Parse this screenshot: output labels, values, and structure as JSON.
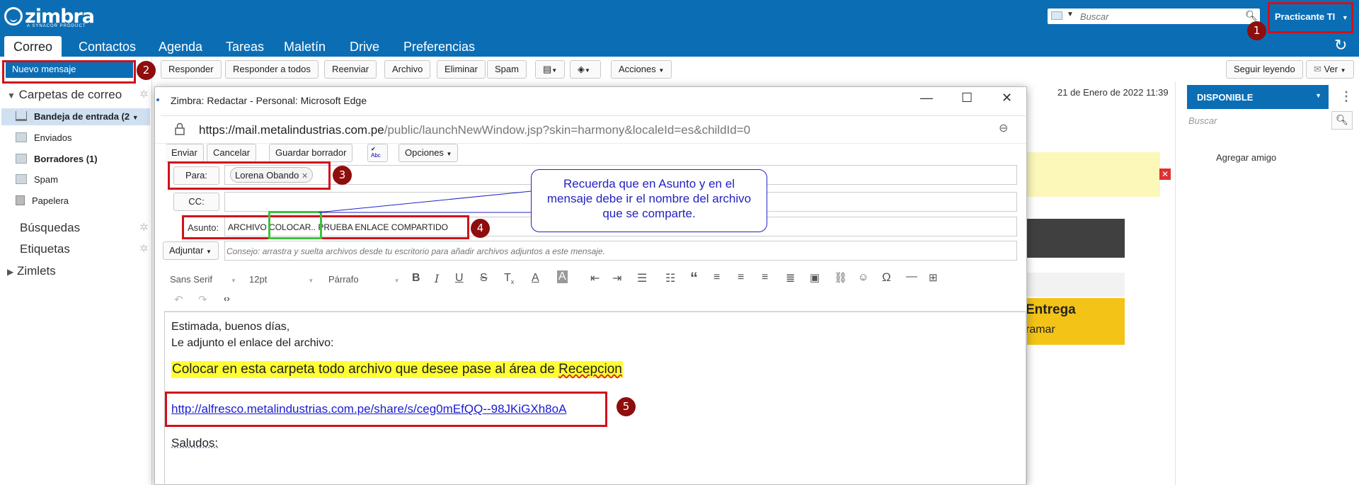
{
  "header": {
    "logo_text": "zimbra",
    "logo_subtext": "A SYNACOR PRODUCT",
    "search_placeholder": "Buscar",
    "user_label": "Practicante TI",
    "tabs": [
      "Correo",
      "Contactos",
      "Agenda",
      "Tareas",
      "Maletín",
      "Drive",
      "Preferencias"
    ],
    "active_tab": "Correo",
    "accent_color": "#0b6eb5"
  },
  "sidebar": {
    "new_message": "Nuevo mensaje",
    "mail_folders_title": "Carpetas de correo",
    "folders": [
      {
        "label": "Bandeja de entrada (2",
        "icon": "inbox-icon",
        "bold": true,
        "selected": true
      },
      {
        "label": "Enviados",
        "icon": "sent-folder-icon",
        "bold": false
      },
      {
        "label": "Borradores (1)",
        "icon": "drafts-folder-icon",
        "bold": true
      },
      {
        "label": "Spam",
        "icon": "spam-folder-icon",
        "bold": false
      },
      {
        "label": "Papelera",
        "icon": "trash-icon",
        "bold": false
      }
    ],
    "searches": "Búsquedas",
    "tags": "Etiquetas",
    "zimlets": "Zimlets"
  },
  "toolbar": {
    "reply": "Responder",
    "reply_all": "Responder a todos",
    "forward": "Reenviar",
    "archive": "Archivo",
    "delete": "Eliminar",
    "spam": "Spam",
    "actions": "Acciones",
    "keep_reading": "Seguir leyendo",
    "view": "Ver"
  },
  "message_view": {
    "date": "21 de Enero de 2022 11:39",
    "banner_title": "Entrega",
    "banner_sub": "ramar"
  },
  "right_panel": {
    "status": "DISPONIBLE",
    "search_placeholder": "Buscar",
    "add_friend": "Agregar amigo"
  },
  "compose_window": {
    "title": "Zimbra: Redactar - Personal: Microsoft Edge",
    "url_host": "https://mail.metalindustrias.com.pe",
    "url_path": "/public/launchNewWindow.jsp?skin=harmony&localeId=es&childId=0",
    "send": "Enviar",
    "cancel": "Cancelar",
    "save_draft": "Guardar borrador",
    "options": "Opciones",
    "to_label": "Para:",
    "to_recipient": "Lorena Obando",
    "cc_label": "CC:",
    "subject_label": "Asunto:",
    "subject_part1": "ARCHIVO",
    "subject_part2": "COLOCAR..",
    "subject_part3": "PRUEBA ENLACE COMPARTIDO",
    "attach": "Adjuntar",
    "attach_hint": "Consejo: arrastra y suelta archivos desde tu escritorio para añadir archivos adjuntos a este mensaje.",
    "font_family": "Sans Serif",
    "font_size": "12pt",
    "block_format": "Párrafo",
    "body_line1": "Estimada, buenos días,",
    "body_line2": "Le adjunto el enlace del archivo:",
    "body_highlight_prefix": "Colocar en esta carpeta todo archivo que desee pase al área de ",
    "body_highlight_word": "Recepcion",
    "body_link": "http://alfresco.metalindustrias.com.pe/share/s/ceg0mEfQQ--98JKiGXh8oA",
    "body_closing": "Saludos:"
  },
  "annotations": {
    "callout_text": "Recuerda que en Asunto y en el mensaje debe ir el nombre del archivo que se comparte.",
    "markers": [
      "1",
      "2",
      "3",
      "4",
      "5"
    ],
    "marker_color": "#8e0d0d",
    "box_color": "#d0111b",
    "highlight_box_color": "#3cc33c",
    "callout_color": "#2323c0"
  }
}
